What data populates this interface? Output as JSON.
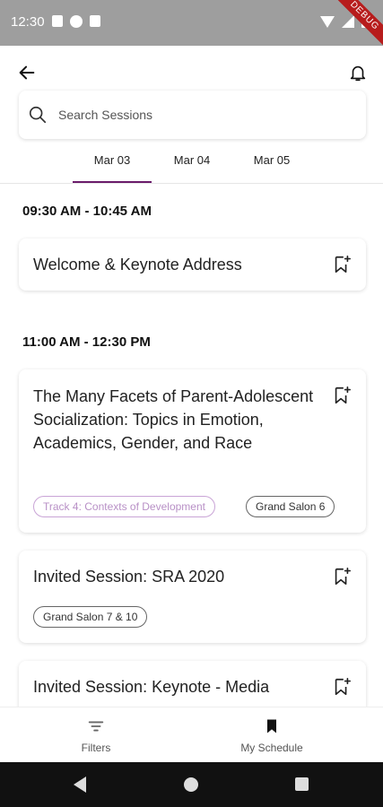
{
  "status_bar": {
    "time": "12:30",
    "debug_label": "DEBUG"
  },
  "search": {
    "placeholder": "Search Sessions"
  },
  "tabs": [
    {
      "label": "Mar 03",
      "active": true
    },
    {
      "label": "Mar 04",
      "active": false
    },
    {
      "label": "Mar 05",
      "active": false
    }
  ],
  "groups": [
    {
      "time": "09:30 AM -  10:45 AM"
    },
    {
      "time": "11:00 AM -  12:30 PM"
    }
  ],
  "sessions": [
    {
      "title": "Welcome & Keynote Address",
      "chips": []
    },
    {
      "title": "The Many Facets of Parent-Adolescent Socialization: Topics in Emotion, Academics, Gender, and Race",
      "chips": [
        "Track 4: Contexts of Development",
        "Grand Salon 6"
      ]
    },
    {
      "title": "Invited Session: SRA 2020",
      "chips": [
        "Grand Salon 7 & 10"
      ]
    },
    {
      "title": "Invited Session: Keynote - Media",
      "chips": []
    }
  ],
  "bottom_nav": {
    "filters": "Filters",
    "my_schedule": "My Schedule"
  },
  "colors": {
    "accent": "#6a1b6a",
    "track_chip": "#c9a4d6",
    "status_bar": "#9e9e9e"
  }
}
